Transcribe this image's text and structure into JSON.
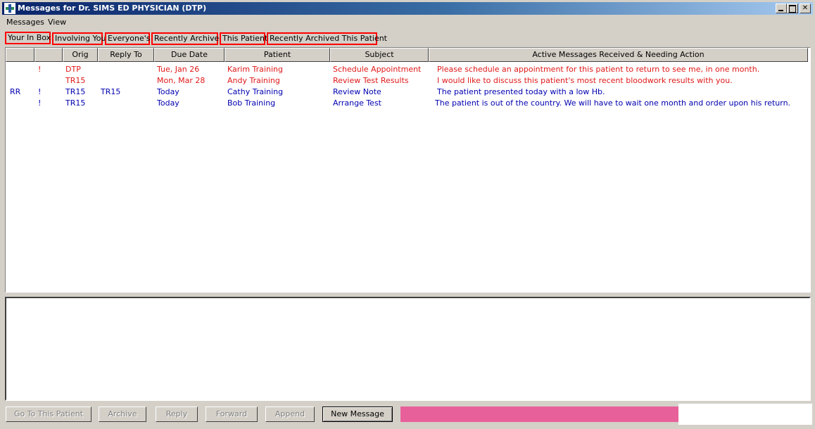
{
  "window": {
    "title": "Messages for Dr. SIMS ED PHYSICIAN (DTP)"
  },
  "menu": {
    "messages": "Messages",
    "view": "View"
  },
  "tabs": [
    {
      "label": "Your In Box",
      "active": true
    },
    {
      "label": "Involving You",
      "active": false
    },
    {
      "label": "Everyone's",
      "active": false
    },
    {
      "label": "Recently Archived",
      "active": false
    },
    {
      "label": "This Patient",
      "active": false
    },
    {
      "label": "Recently Archived This Patient",
      "active": false
    }
  ],
  "list": {
    "columns": [
      "",
      "",
      "Orig",
      "Reply To",
      "Due Date",
      "Patient",
      "Subject",
      "Active Messages Received & Needing Action"
    ],
    "rows": [
      {
        "flag": "",
        "priority": "!",
        "orig": "DTP",
        "reply_to": "",
        "due": "Tue, Jan 26",
        "patient": "Karim Training",
        "subject": "Schedule Appointment",
        "message": "Please schedule an appointment for this patient to return to see me, in one month.",
        "color": "#e01818"
      },
      {
        "flag": "",
        "priority": "",
        "orig": "TR15",
        "reply_to": "",
        "due": "Mon, Mar 28",
        "patient": "Andy Training",
        "subject": "Review Test Results",
        "message": "I would like to discuss this patient's most recent bloodwork results with you.",
        "color": "#e01818"
      },
      {
        "flag": "RR",
        "priority": "!",
        "orig": "TR15",
        "reply_to": "TR15",
        "due": "Today",
        "patient": "Cathy Training",
        "subject": "Review Note",
        "message": "The patient presented today with a low Hb.",
        "color": "#0000b0"
      },
      {
        "flag": "",
        "priority": "!",
        "orig": "TR15",
        "reply_to": "",
        "due": "Today",
        "patient": "Bob Training",
        "subject": "Arrange Test",
        "message": "The patient is out of the country. We will have to wait one month and order upon his return.",
        "color": "#0000b0"
      }
    ]
  },
  "buttons": {
    "go_to_patient": "Go To This Patient",
    "archive": "Archive",
    "reply": "Reply",
    "forward": "Forward",
    "append": "Append",
    "new_message": "New Message"
  },
  "colors": {
    "status_bar": "#e8609a",
    "tab_highlight": "#ff0000"
  }
}
